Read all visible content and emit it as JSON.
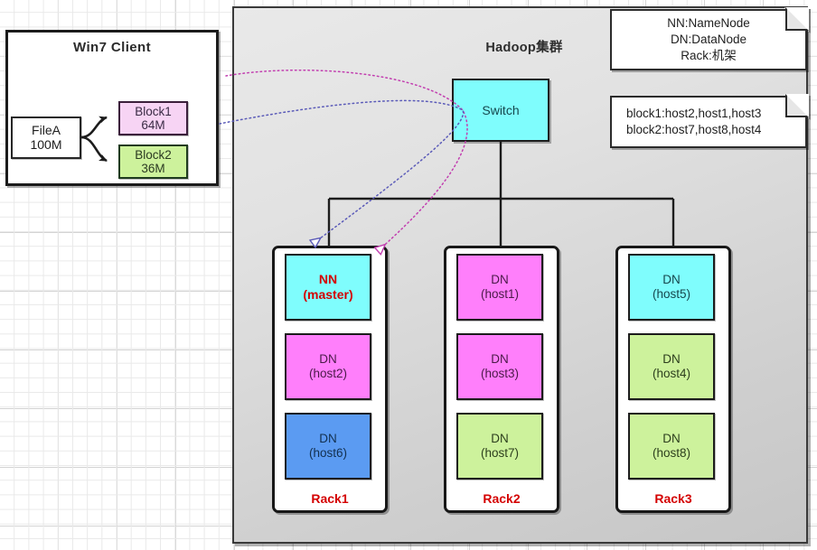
{
  "client": {
    "title": "Win7 Client",
    "file": {
      "name": "FileA",
      "size": "100M"
    },
    "blocks": [
      {
        "name": "Block1",
        "size": "64M",
        "color": "#f7d4f4"
      },
      {
        "name": "Block2",
        "size": "36M",
        "color": "#cdf29c"
      }
    ]
  },
  "cluster": {
    "title": "Hadoop集群",
    "switch_label": "Switch",
    "racks": [
      {
        "label": "Rack1",
        "nodes": [
          {
            "role": "NN",
            "host": "(master)",
            "color": "#7ffdfd",
            "style": "nn"
          },
          {
            "role": "DN",
            "host": "(host2)",
            "color": "#ff7ffb",
            "style": "dn"
          },
          {
            "role": "DN",
            "host": "(host6)",
            "color": "#5b9bf2",
            "style": "dn"
          }
        ]
      },
      {
        "label": "Rack2",
        "nodes": [
          {
            "role": "DN",
            "host": "(host1)",
            "color": "#ff7ffb",
            "style": "dn"
          },
          {
            "role": "DN",
            "host": "(host3)",
            "color": "#ff7ffb",
            "style": "dn"
          },
          {
            "role": "DN",
            "host": "(host7)",
            "color": "#cdf29c",
            "style": "dn"
          }
        ]
      },
      {
        "label": "Rack3",
        "nodes": [
          {
            "role": "DN",
            "host": "(host5)",
            "color": "#7ffdfd",
            "style": "dn"
          },
          {
            "role": "DN",
            "host": "(host4)",
            "color": "#cdf29c",
            "style": "dn"
          },
          {
            "role": "DN",
            "host": "(host8)",
            "color": "#cdf29c",
            "style": "dn"
          }
        ]
      }
    ]
  },
  "legend_note": {
    "line1": "NN:NameNode",
    "line2": "DN:DataNode",
    "line3": "Rack:机架"
  },
  "block_note": {
    "line1": "block1:host2,host1,host3",
    "line2": "block2:host7,host8,host4"
  },
  "colors": {
    "cyan": "#7ffdfd",
    "magenta": "#ff7ffb",
    "blue": "#5b9bf2",
    "green": "#cdf29c",
    "pink_light": "#f7d4f4",
    "red_text": "#d40000",
    "arrow_magenta": "#cc44bb",
    "arrow_blue": "#5a5ab8",
    "panel_gray": "#dcdcdc"
  }
}
